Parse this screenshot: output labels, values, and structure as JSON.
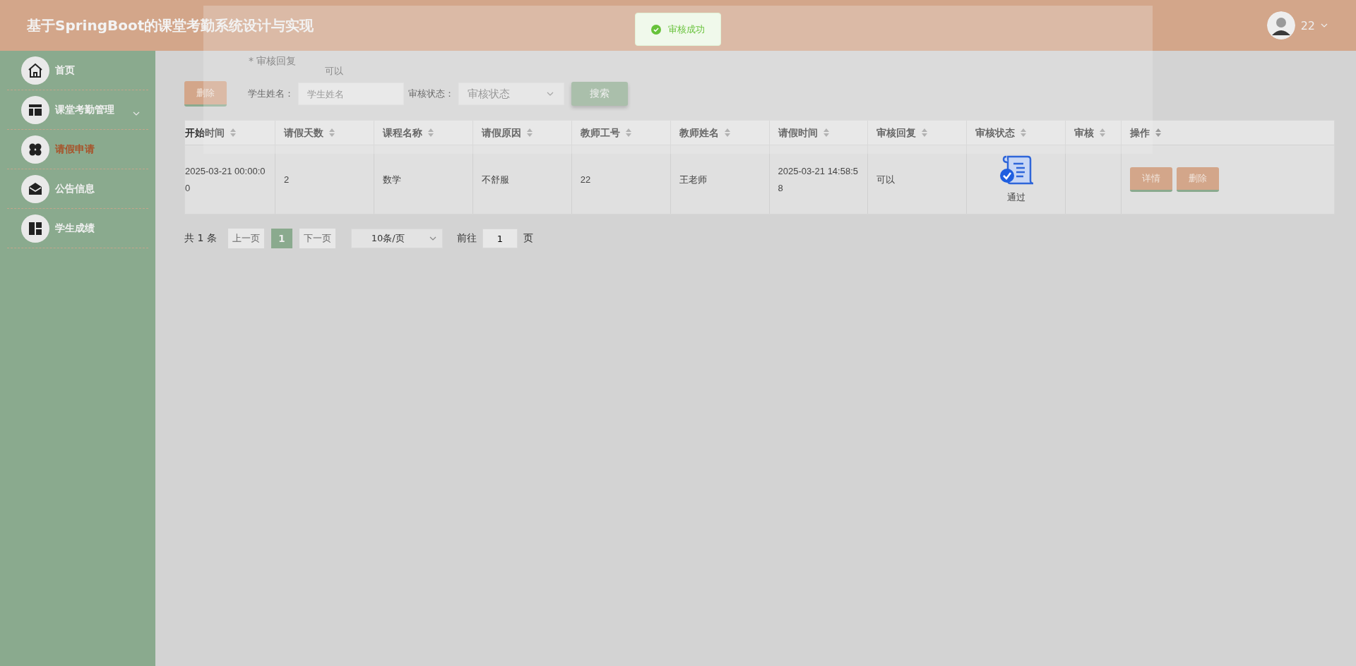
{
  "header": {
    "title": "基于SpringBoot的课堂考勤系统设计与实现",
    "user": {
      "name": "22"
    }
  },
  "toast": {
    "kind": "success",
    "message": "审核成功"
  },
  "dialog_ghost": {
    "label": "* 审核回复",
    "value": "可以"
  },
  "sidebar": {
    "items": [
      {
        "label": "首页",
        "selected": false,
        "expandable": false
      },
      {
        "label": "课堂考勤管理",
        "selected": false,
        "expandable": true
      },
      {
        "label": "请假申请",
        "selected": true,
        "expandable": false
      },
      {
        "label": "公告信息",
        "selected": false,
        "expandable": false
      },
      {
        "label": "学生成绩",
        "selected": false,
        "expandable": false
      }
    ]
  },
  "toolbar": {
    "delete_button": "删除",
    "filters": [
      {
        "kind": "input",
        "label": "学生姓名：",
        "placeholder": "学生姓名"
      },
      {
        "kind": "select",
        "label": "审核状态：",
        "placeholder": "审核状态"
      }
    ],
    "search_button": "搜索"
  },
  "table": {
    "columns": [
      "开始时间",
      "请假天数",
      "课程名称",
      "请假原因",
      "教师工号",
      "教师姓名",
      "请假时间",
      "审核回复",
      "审核状态",
      "审核",
      "操作"
    ],
    "rows": [
      {
        "cells": [
          "2025-03-21 00:00:00",
          "2",
          "数学",
          "不舒服",
          "22",
          "王老师",
          "2025-03-21 14:58:58",
          "可以"
        ],
        "status": {
          "kind": "passed",
          "label": "通过"
        },
        "actions": [
          "详情",
          "删除"
        ]
      }
    ]
  },
  "pagination": {
    "total": "共 1 条",
    "prev": "上一页",
    "pages": [
      {
        "label": "1",
        "selected": true
      }
    ],
    "next": "下一页",
    "page_size": "10条/页",
    "goto_label": "前往",
    "goto_value": "1",
    "goto_suffix": "页"
  }
}
